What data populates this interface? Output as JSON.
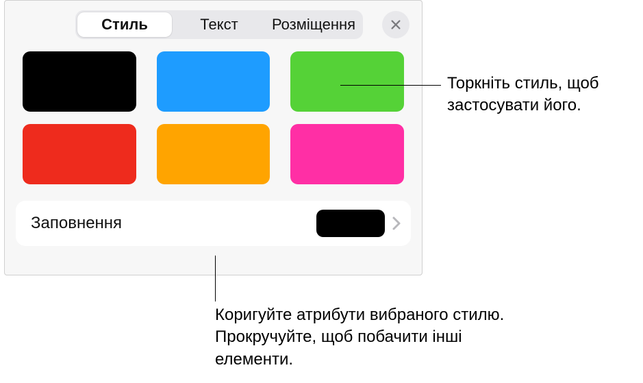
{
  "tabs": {
    "style": "Стиль",
    "text": "Текст",
    "layout": "Розміщення"
  },
  "swatches": {
    "c0": "#000000",
    "c1": "#1e9cff",
    "c2": "#55d237",
    "c3": "#ee2b1d",
    "c4": "#ffa400",
    "c5": "#ff2fa5"
  },
  "fill": {
    "label": "Заповнення",
    "preview_color": "#000000"
  },
  "callouts": {
    "top_right": "Торкніть стиль, щоб застосувати його.",
    "bottom": "Коригуйте атрибути вибраного стилю. Прокручуйте, щоб побачити інші елементи."
  }
}
